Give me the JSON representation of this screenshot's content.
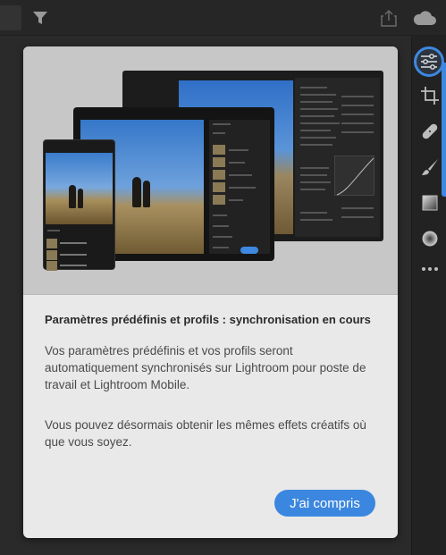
{
  "topbar": {
    "filter_icon": "filter-icon",
    "share_icon": "share-icon",
    "cloud_icon": "cloud-icon"
  },
  "sidebar": {
    "tools": [
      {
        "name": "adjustments-icon",
        "active": true
      },
      {
        "name": "crop-rotate-icon",
        "active": false
      },
      {
        "name": "healing-icon",
        "active": false
      },
      {
        "name": "brush-icon",
        "active": false
      },
      {
        "name": "linear-gradient-icon",
        "active": false
      },
      {
        "name": "radial-gradient-icon",
        "active": false
      },
      {
        "name": "more-icon",
        "active": false
      }
    ],
    "accent_color": "#3d88e0"
  },
  "dialog": {
    "title": "Paramètres prédéfinis et profils : synchronisation en cours",
    "paragraph1": "Vos paramètres prédéfinis et vos profils seront automatiquement synchronisés sur Lightroom pour poste de travail et Lightroom Mobile.",
    "paragraph2": "Vous pouvez désormais obtenir les mêmes effets créatifs où que vous soyez.",
    "confirm_label": "J'ai compris",
    "button_color": "#3b87df"
  }
}
